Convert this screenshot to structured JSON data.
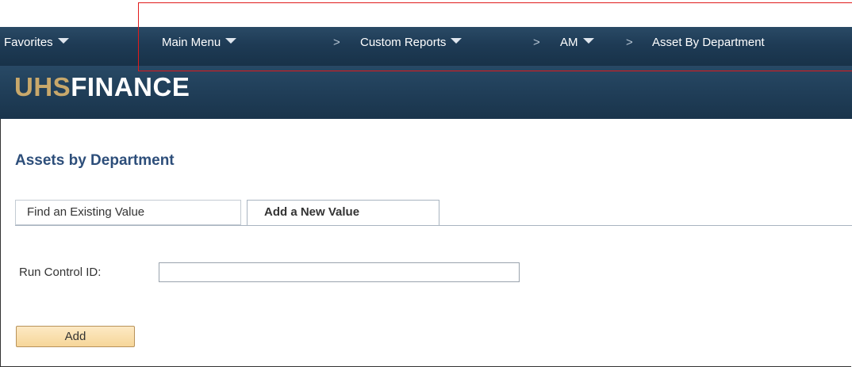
{
  "nav": {
    "favorites": "Favorites",
    "main_menu": "Main Menu",
    "breadcrumb": [
      {
        "label": "Custom Reports",
        "has_menu": true
      },
      {
        "label": "AM",
        "has_menu": true
      },
      {
        "label": "Asset By Department",
        "has_menu": false
      }
    ],
    "separator": ">",
    "icons": {
      "menu_caret": "caret-down-icon"
    }
  },
  "banner": {
    "logo_part1": "UHS",
    "logo_part2": "FINANCE"
  },
  "page": {
    "title": "Assets by Department",
    "tabs": [
      {
        "label": "Find an Existing Value",
        "active": false
      },
      {
        "label": "Add a New Value",
        "active": true
      }
    ],
    "form": {
      "run_control_label": "Run Control ID:",
      "run_control_value": ""
    },
    "add_button": "Add"
  },
  "colors": {
    "nav_bg": "#1e3b55",
    "title_text": "#2d4e7a",
    "logo_gold": "#c8a86b",
    "button_bg": "#f6d699",
    "highlight": "#e01b1b"
  }
}
